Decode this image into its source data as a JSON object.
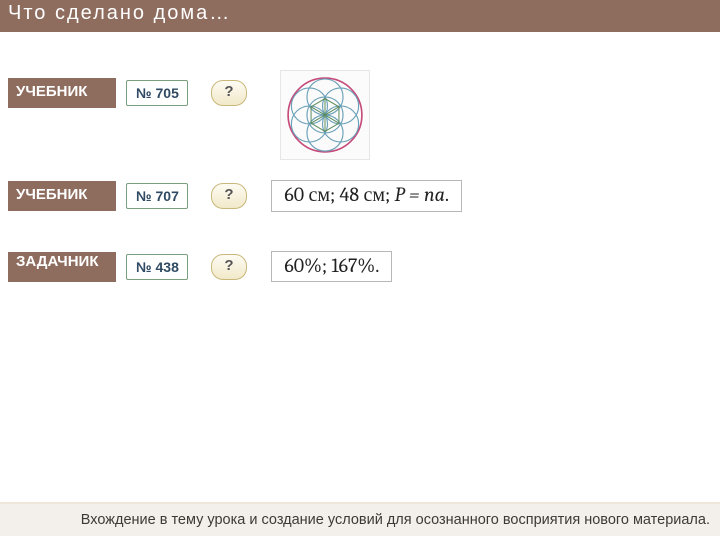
{
  "header": {
    "title": "Что  сделано  дома…"
  },
  "rows": [
    {
      "source": "УЧЕБНИК",
      "num": "№ 705",
      "q": "?",
      "answer": null
    },
    {
      "source": "УЧЕБНИК",
      "num": "№ 707",
      "q": "?",
      "answer_plain_a": "60 см;  48 см;  ",
      "answer_italic": "P = na",
      "answer_plain_b": "."
    },
    {
      "source": "ЗАДАЧНИК",
      "num": "№ 438",
      "q": "?",
      "answer": "60%;  167%."
    }
  ],
  "footer": {
    "text": "Вхождение в тему урока и создание условий для осознанного восприятия нового материала."
  }
}
